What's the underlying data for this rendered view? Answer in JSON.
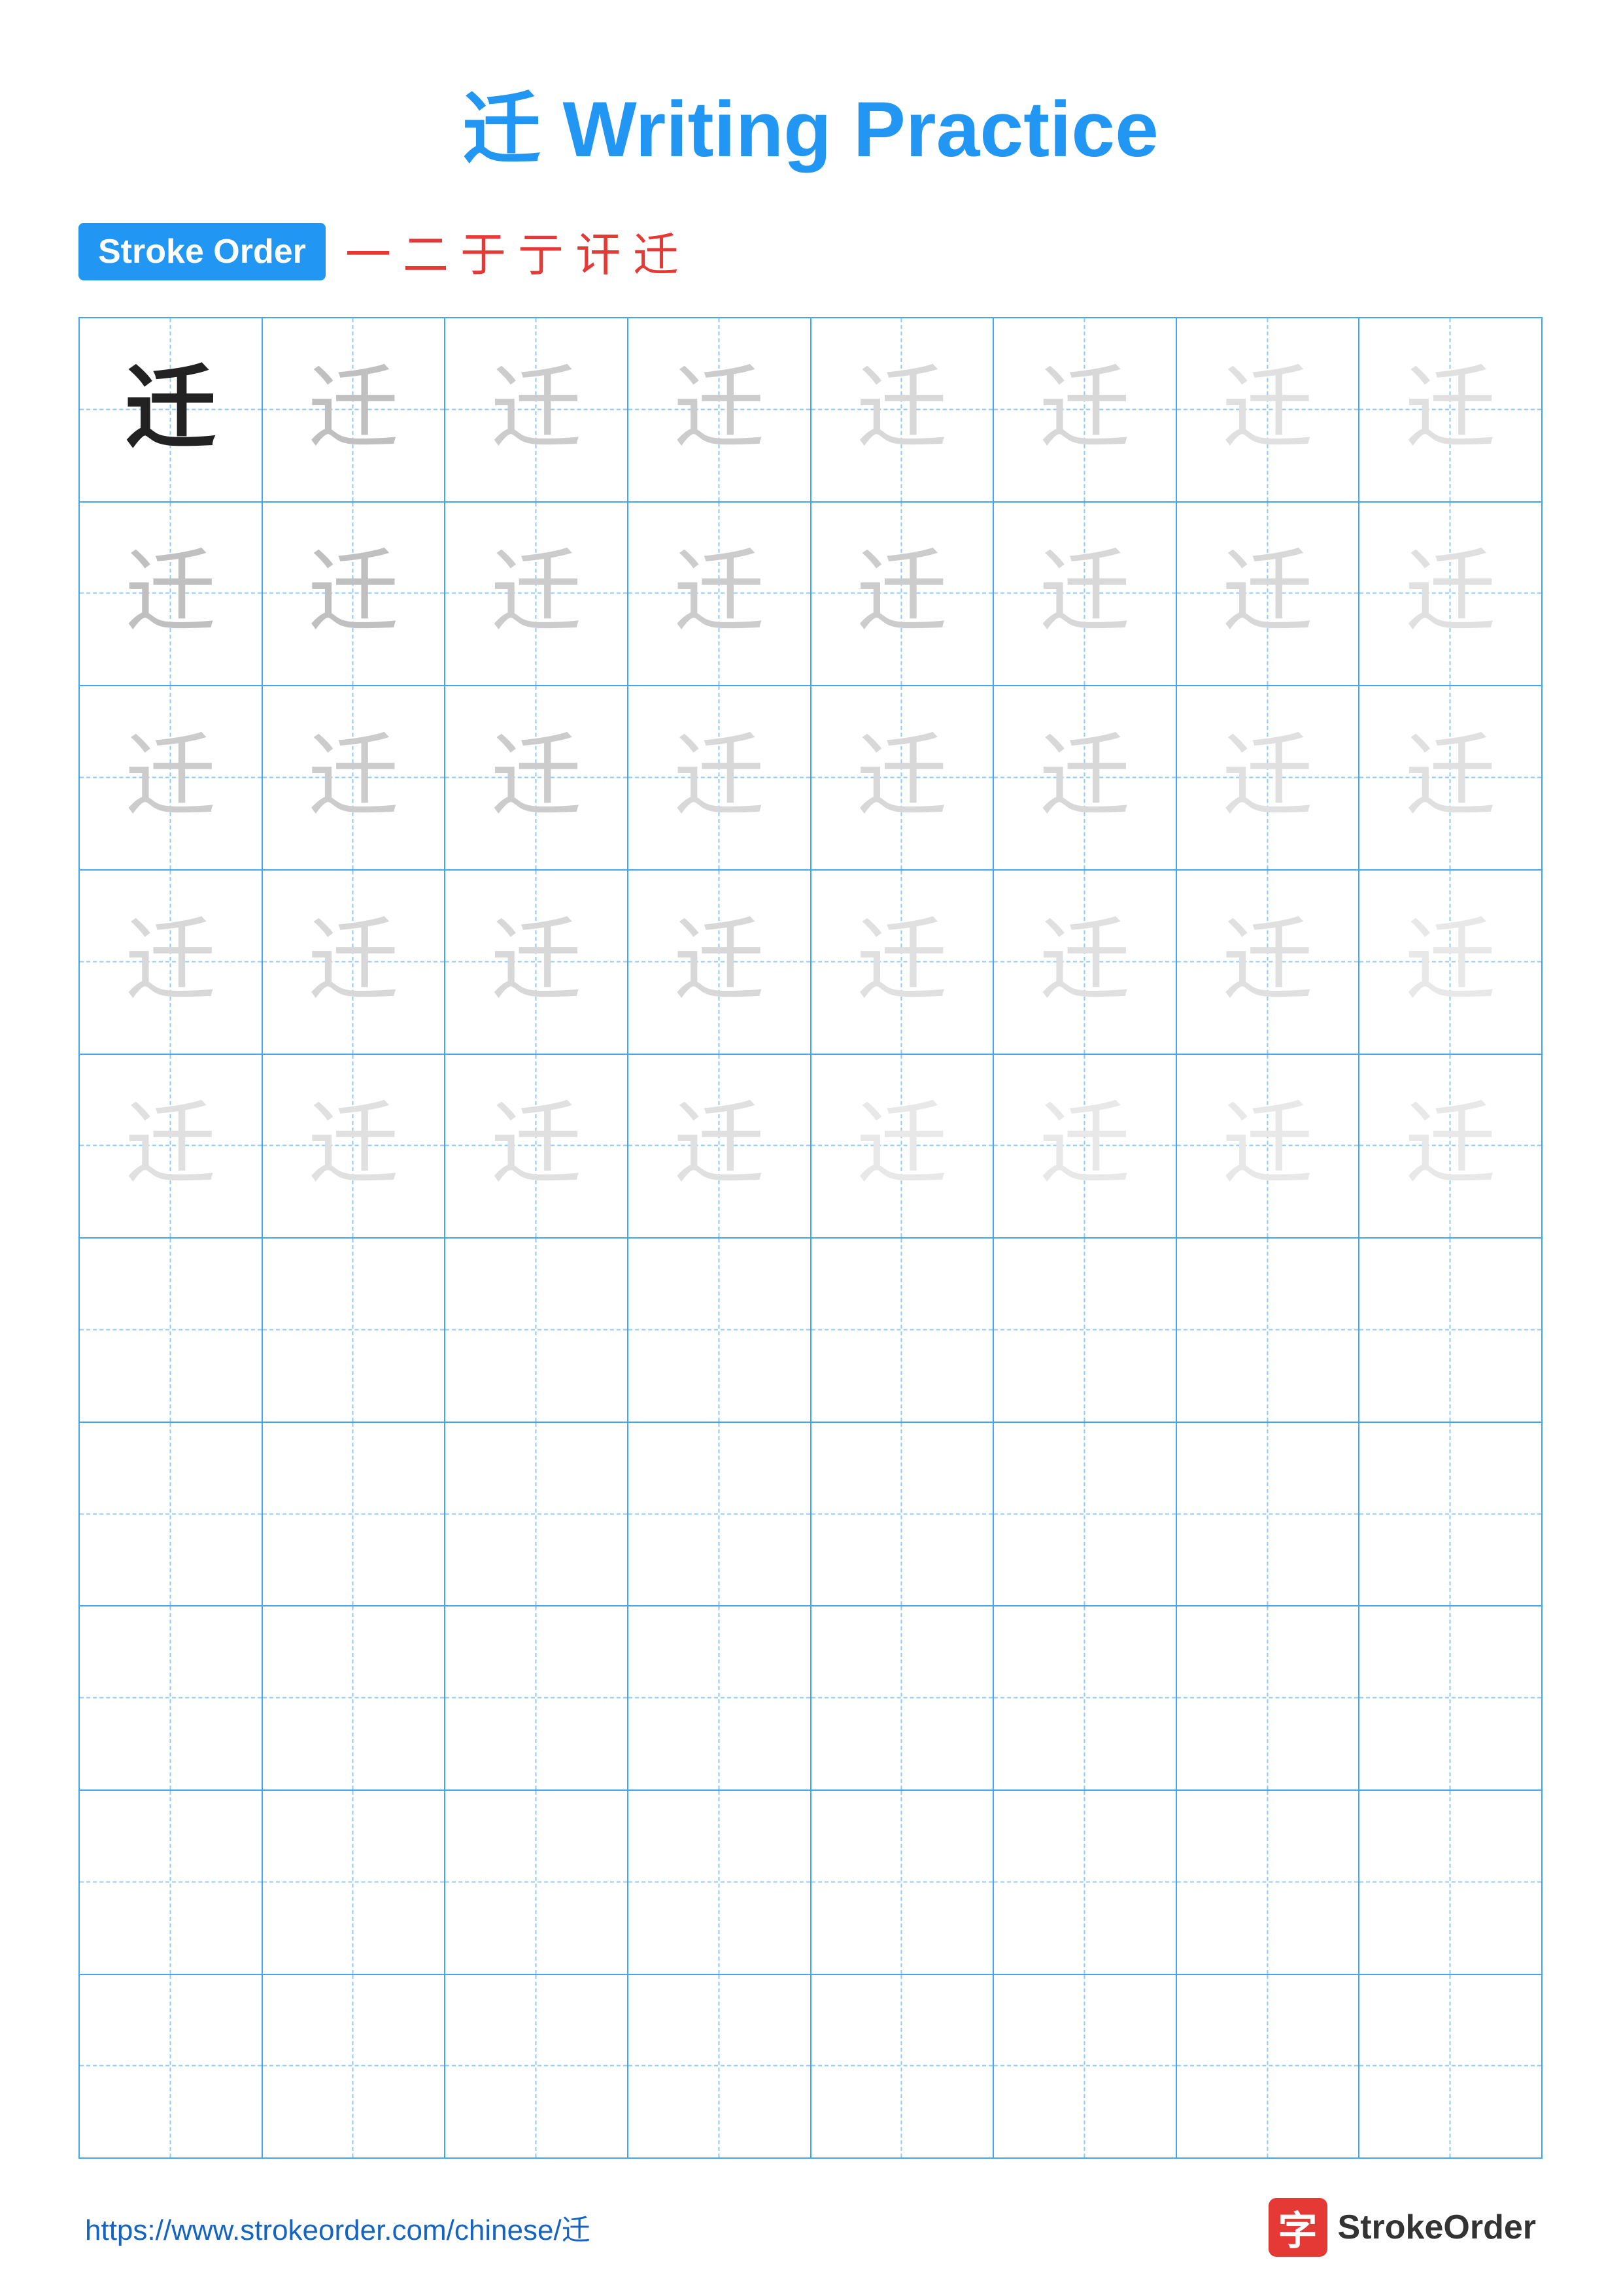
{
  "page": {
    "title": "迁 Writing Practice",
    "title_char": "迁",
    "title_text": " Writing Practice"
  },
  "stroke_order": {
    "badge_label": "Stroke Order",
    "strokes": [
      "一",
      "二",
      "于",
      "亍",
      "讦",
      "迁"
    ]
  },
  "grid": {
    "rows": 10,
    "cols": 8,
    "character": "迁",
    "practice_rows": 5,
    "empty_rows": 5
  },
  "footer": {
    "url": "https://www.strokeorder.com/chinese/迁",
    "brand_name": "StrokeOrder",
    "brand_char": "字"
  }
}
